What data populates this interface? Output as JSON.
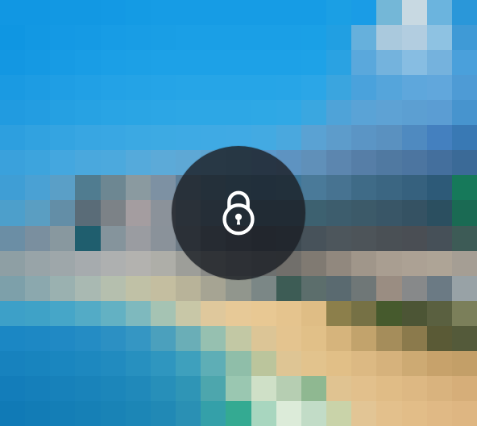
{
  "overlay": {
    "icon": "lock-icon",
    "state": "locked"
  },
  "colors": {
    "sky": "#1f8fd4",
    "ocean": "#1f86be",
    "sand": "#e3c59b",
    "overlay": "#1c2026"
  },
  "mosaic": {
    "cols": 19,
    "rows": 17,
    "tiles": [
      "#1197e3",
      "#1197e3",
      "#1298e3",
      "#1298e3",
      "#1399e4",
      "#149be4",
      "#169ce5",
      "#169ce5",
      "#169ce5",
      "#169ce5",
      "#169ce5",
      "#169ce5",
      "#169ce5",
      "#1b9fe4",
      "#1a9ce6",
      "#74b7d7",
      "#c8d9e2",
      "#6bb4de",
      "#2a97d9",
      "#0f96e2",
      "#1298e3",
      "#1499e4",
      "#159ae4",
      "#179ce5",
      "#189de5",
      "#199ee5",
      "#1a9fe6",
      "#1a9fe6",
      "#1a9fe6",
      "#1a9fe6",
      "#1a9fe6",
      "#1aa0e6",
      "#219fe2",
      "#66b0dc",
      "#aac9dd",
      "#b2cde0",
      "#8ec2e2",
      "#3f9ad6",
      "#1397e2",
      "#1599e3",
      "#179be4",
      "#199de5",
      "#1b9fe6",
      "#1ca0e6",
      "#1da1e7",
      "#1da1e7",
      "#1da1e7",
      "#1da1e7",
      "#1da1e7",
      "#1da1e7",
      "#1ea2e7",
      "#2aa2e2",
      "#5aa8dc",
      "#74b3dd",
      "#87bde2",
      "#75b2dd",
      "#4aa0db",
      "#1a9ae2",
      "#1d9ce3",
      "#1f9ee4",
      "#21a0e5",
      "#23a2e6",
      "#24a3e6",
      "#25a4e7",
      "#26a5e7",
      "#26a5e7",
      "#26a5e7",
      "#26a5e7",
      "#27a5e7",
      "#2ba6e7",
      "#3aa5df",
      "#4aa2dc",
      "#55a5db",
      "#5ea7dc",
      "#61a7dc",
      "#4e9bd5",
      "#219be0",
      "#239de1",
      "#25a0e2",
      "#27a2e3",
      "#29a4e4",
      "#2aa5e4",
      "#2ca6e5",
      "#2da7e5",
      "#2da7e5",
      "#2da7e5",
      "#2ea8e5",
      "#30a8e5",
      "#3aa7e0",
      "#4fa3d8",
      "#5aa3d6",
      "#5ea2d4",
      "#5c9fd2",
      "#5b9dd3",
      "#4794ce",
      "#2d9fdf",
      "#31a2e0",
      "#34a4e1",
      "#38a6e2",
      "#39a7e3",
      "#3ba9e3",
      "#3daae3",
      "#3eaae4",
      "#3faae4",
      "#40aae4",
      "#43aae2",
      "#4aa8de",
      "#5aa2d3",
      "#5d9ccb",
      "#5b95c5",
      "#5a91c0",
      "#4f8ac0",
      "#4480bf",
      "#3979b4",
      "#3aa1dc",
      "#3da4dd",
      "#44a7df",
      "#4aa8dd",
      "#4ca9dd",
      "#55aadb",
      "#5caad8",
      "#5ea8d5",
      "#5da4d0",
      "#5c9ece",
      "#5c98ca",
      "#5e93c1",
      "#6090b9",
      "#5c86af",
      "#567ea7",
      "#5079a1",
      "#4c75a0",
      "#446f9d",
      "#3b6a97",
      "#3f9ed5",
      "#4aa1d4",
      "#5a9fc7",
      "#507c90",
      "#6d8792",
      "#8a9aa0",
      "#7d91a3",
      "#5f7f98",
      "#4c7a98",
      "#3f7899",
      "#3b779b",
      "#3f789b",
      "#4a7a99",
      "#477391",
      "#3f6b87",
      "#3b6682",
      "#36617e",
      "#2d5a78",
      "#16795a",
      "#4d9fcb",
      "#5a9ec2",
      "#638ea7",
      "#5a6c78",
      "#7c8287",
      "#a49da0",
      "#8b929a",
      "#69808f",
      "#4f6f83",
      "#3e6579",
      "#375f73",
      "#3a6073",
      "#3d6170",
      "#3d5d6d",
      "#3c5a69",
      "#395667",
      "#355263",
      "#2b4f60",
      "#1a6a53",
      "#6b8ea5",
      "#7a8f9f",
      "#88989f",
      "#1f5e6e",
      "#85949c",
      "#9a9ca1",
      "#8a929a",
      "#6e7b86",
      "#575f69",
      "#47505b",
      "#3d4650",
      "#3e4a52",
      "#47525a",
      "#4d565c",
      "#4d5459",
      "#4a5055",
      "#4a4e54",
      "#465058",
      "#3d5b56",
      "#8e9fa4",
      "#98a4a8",
      "#9ea7aa",
      "#a6abae",
      "#aeb0b0",
      "#b3b2af",
      "#aeaea8",
      "#9d9e99",
      "#8a8b88",
      "#787a78",
      "#6d706f",
      "#716f6b",
      "#807a72",
      "#91887e",
      "#a0968a",
      "#a99e91",
      "#aca194",
      "#aea496",
      "#a59e94",
      "#7da0aa",
      "#8ba8ae",
      "#9ab1b0",
      "#a9b9b2",
      "#b5bfae",
      "#c0c1a6",
      "#c4bea0",
      "#b8b399",
      "#a6a493",
      "#91968d",
      "#7b8786",
      "#3d5c55",
      "#5c6e6c",
      "#5a6a70",
      "#6f7777",
      "#9a8d82",
      "#87898a",
      "#6b7a84",
      "#98a2a6",
      "#3da0c8",
      "#3fa2c7",
      "#46a6c8",
      "#53abc6",
      "#63b1c3",
      "#7eb9be",
      "#a5c3b3",
      "#c8c7a7",
      "#dfc89c",
      "#e7c997",
      "#e8c893",
      "#e5c48e",
      "#dfbd85",
      "#8c7f4b",
      "#767145",
      "#465a2d",
      "#4c5535",
      "#5a6040",
      "#7b7f5a",
      "#1b87c4",
      "#1d88c4",
      "#2089c4",
      "#248cc4",
      "#2c90c3",
      "#3596c3",
      "#4ba0bd",
      "#6aaeb7",
      "#96c0b0",
      "#c2c8a4",
      "#dcc596",
      "#e4c48f",
      "#e1c088",
      "#d6b47c",
      "#c2a36c",
      "#a58d5b",
      "#8b7a4c",
      "#5a5a36",
      "#545a3a",
      "#1782be",
      "#1884be",
      "#1a86bf",
      "#1d88bf",
      "#218bbf",
      "#2790bf",
      "#2f96bf",
      "#3ea0bd",
      "#5eaeb6",
      "#8fbea9",
      "#bbc59c",
      "#dec594",
      "#e2c38d",
      "#e1bf87",
      "#dcb983",
      "#d6b27c",
      "#cdaa73",
      "#c7a26b",
      "#c39f68",
      "#137dba",
      "#157fba",
      "#1781ba",
      "#1983ba",
      "#1c86ba",
      "#2089ba",
      "#278fb9",
      "#2f95b6",
      "#4da6ad",
      "#9ac7b1",
      "#cfe0c7",
      "#b6ceb2",
      "#8fb891",
      "#e0c391",
      "#e2c08c",
      "#e0bc86",
      "#ddb883",
      "#d9b37e",
      "#d6ae79",
      "#107ab6",
      "#127cb6",
      "#147eb6",
      "#1680b6",
      "#1983b6",
      "#1c86b6",
      "#2189b5",
      "#2a90b4",
      "#34a0a9",
      "#34aa92",
      "#a8d6bf",
      "#dcebd9",
      "#c2dcc7",
      "#c9d3a9",
      "#e2c595",
      "#e3c08c",
      "#e2bd88",
      "#e0b985",
      "#deb682"
    ]
  }
}
